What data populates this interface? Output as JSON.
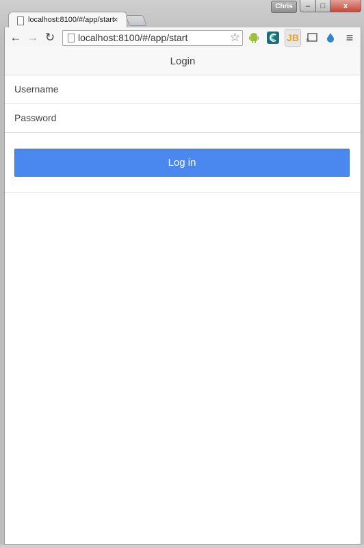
{
  "browser": {
    "profile_name": "Chris",
    "tab": {
      "title": "localhost:8100/#/app/start",
      "close_glyph": "×"
    },
    "url": "localhost:8100/#/app/start",
    "nav": {
      "back": "←",
      "forward": "→",
      "reload": "↻",
      "star": "☆",
      "menu": "≡"
    },
    "extensions": [
      {
        "name": "android-icon"
      },
      {
        "name": "c-extension-icon"
      },
      {
        "name": "jb-icon",
        "label": "JB"
      },
      {
        "name": "cast-icon"
      },
      {
        "name": "drop-icon"
      }
    ],
    "window_controls": {
      "minimize": "–",
      "maximize": "□",
      "close": "x"
    }
  },
  "app": {
    "header_title": "Login",
    "username_placeholder": "Username",
    "password_placeholder": "Password",
    "login_button": "Log in"
  },
  "colors": {
    "primary_button": "#4a87ee"
  }
}
